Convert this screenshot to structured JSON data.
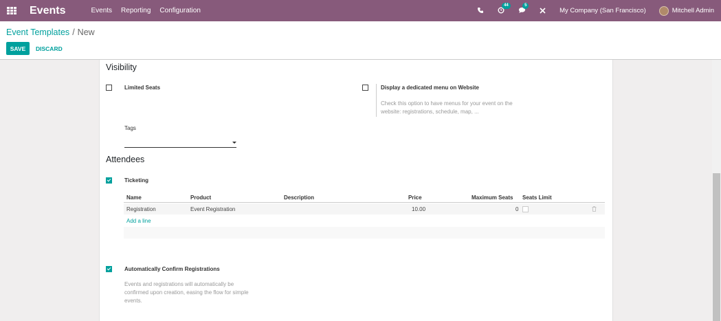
{
  "navbar": {
    "app_name": "Events",
    "menus": [
      "Events",
      "Reporting",
      "Configuration"
    ],
    "phone_icon": "phone-icon",
    "activity_count": "44",
    "messages_count": "5",
    "company": "My Company (San Francisco)",
    "user": "Mitchell Admin",
    "brand_color": "#875a7b"
  },
  "breadcrumb": {
    "parent": "Event Templates",
    "separator": "/",
    "current": "New"
  },
  "buttons": {
    "save": "SAVE",
    "discard": "DISCARD",
    "accent_color": "#00a09d"
  },
  "visibility": {
    "title": "Visibility",
    "limited_seats_label": "Limited Seats",
    "limited_seats_checked": false,
    "website_menu_label": "Display a dedicated menu on Website",
    "website_menu_checked": false,
    "website_menu_help_1": "Check this option to have menus for your event on the",
    "website_menu_help_2": "website: registrations, schedule, map, ...",
    "tags_label": "Tags",
    "tags_value": ""
  },
  "attendees": {
    "title": "Attendees",
    "ticketing_label": "Ticketing",
    "ticketing_checked": true,
    "columns": {
      "name": "Name",
      "product": "Product",
      "description": "Description",
      "price": "Price",
      "max_seats": "Maximum Seats",
      "seats_limit": "Seats Limit"
    },
    "rows": [
      {
        "name": "Registration",
        "product": "Event Registration",
        "description": "",
        "price": "10.00",
        "max_seats": "0",
        "seats_limit": false
      }
    ],
    "add_line": "Add a line",
    "auto_confirm_label": "Automatically Confirm Registrations",
    "auto_confirm_checked": true,
    "auto_confirm_help_1": "Events and registrations will automatically be",
    "auto_confirm_help_2": "confirmed upon creation, easing the flow for simple",
    "auto_confirm_help_3": "events."
  }
}
